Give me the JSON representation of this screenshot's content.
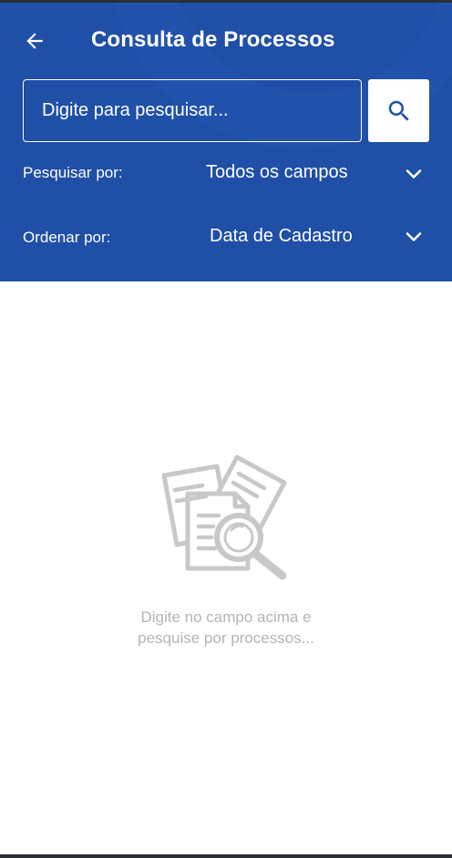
{
  "header": {
    "title": "Consulta de Processos",
    "back_icon": "arrow-left-icon",
    "colors": {
      "background": "#1f4fa6",
      "text": "#ffffff"
    }
  },
  "search": {
    "placeholder": "Digite para pesquisar...",
    "value": "",
    "button_icon": "search-icon"
  },
  "filters": {
    "search_by": {
      "label": "Pesquisar por:",
      "value": "Todos os campos",
      "icon": "chevron-down-icon"
    },
    "order_by": {
      "label": "Ordenar por:",
      "value": "Data de Cadastro",
      "icon": "chevron-down-icon"
    }
  },
  "empty_state": {
    "icon": "documents-search-icon",
    "line1": "Digite no campo acima e",
    "line2": "pesquise por processos..."
  }
}
